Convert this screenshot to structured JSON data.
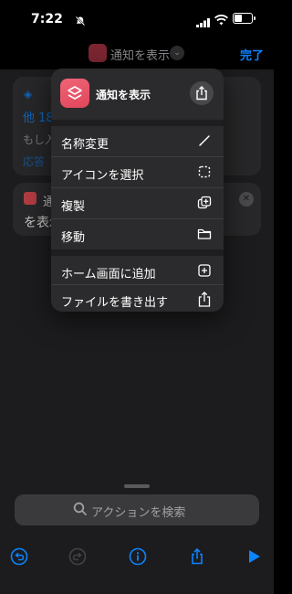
{
  "status_bar": {
    "time": "7:22"
  },
  "nav": {
    "title": "通知を表示",
    "done_label": "完了"
  },
  "background": {
    "card1": {
      "line1": "他 18",
      "line2": "もし入",
      "line3": "応答"
    },
    "card2": {
      "line1": "通",
      "line2": "を表示"
    }
  },
  "menu": {
    "title": "通知を表示",
    "items": [
      {
        "label": "名称変更",
        "icon": "pencil-icon"
      },
      {
        "label": "アイコンを選択",
        "icon": "dashed-square-icon"
      },
      {
        "label": "複製",
        "icon": "duplicate-icon"
      },
      {
        "label": "移動",
        "icon": "folder-icon"
      },
      {
        "label": "ホーム画面に追加",
        "icon": "plus-square-icon"
      },
      {
        "label": "ファイルを書き出す",
        "icon": "export-icon"
      }
    ]
  },
  "sheet": {
    "search_placeholder": "アクションを検索"
  },
  "colors": {
    "accent": "#0a84ff",
    "app_icon": "#e0465a"
  }
}
